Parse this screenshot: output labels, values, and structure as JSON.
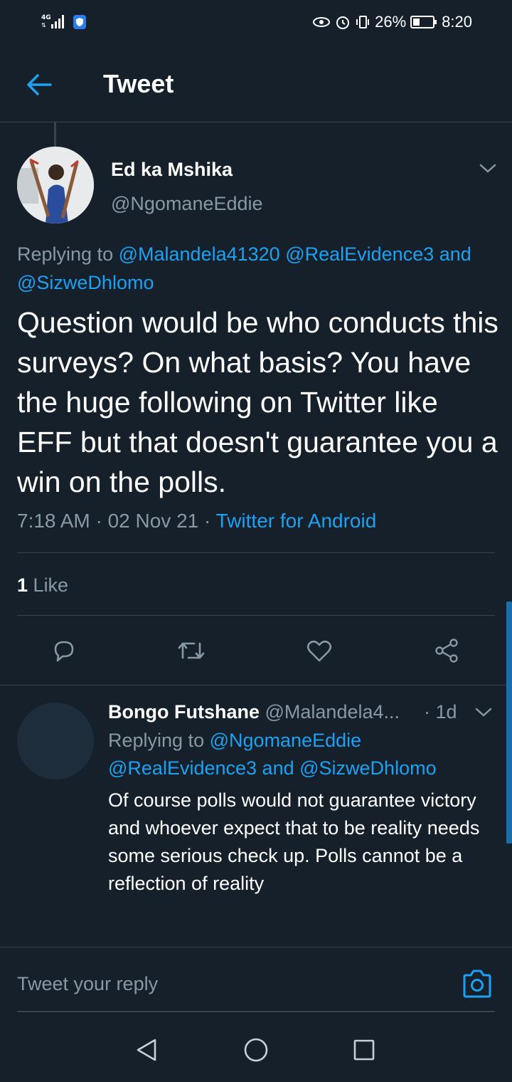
{
  "status_bar": {
    "network": "4G",
    "battery": "26%",
    "time": "8:20"
  },
  "header": {
    "title": "Tweet"
  },
  "tweet": {
    "author_name": "Ed ka Mshika",
    "author_handle": "@NgomaneEddie",
    "replying_prefix": "Replying to",
    "mention_1": "@Malandela41320",
    "mention_2": "@RealEvidence3",
    "replying_and": "and",
    "mention_3": "@SizweDhlomo",
    "text": "Question would be who conducts this surveys? On what basis? You have the huge following on Twitter like EFF but that doesn't guarantee you a win on the polls.",
    "time": "7:18 AM · 02 Nov 21 · ",
    "source": "Twitter for Android",
    "like_count": "1",
    "like_label": "Like"
  },
  "reply": {
    "author_name": "Bongo Futshane",
    "author_handle": "@Malandela4...",
    "age": "· 1d",
    "replying_prefix": "Replying to",
    "mention_1": "@NgomaneEddie",
    "mention_2": "@RealEvidence3",
    "replying_and": "and",
    "mention_3": "@SizweDhlomo",
    "text": "Of course polls would not guarantee victory and whoever expect that to be reality needs some serious check up. Polls cannot be a reflection of reality"
  },
  "compose": {
    "placeholder": "Tweet your reply"
  },
  "icons": {
    "accent": "#1da1f2",
    "back": "arrow-left-icon",
    "reply": "comment-icon",
    "retweet": "retweet-icon",
    "like": "heart-icon",
    "share": "share-icon",
    "camera": "camera-icon"
  }
}
